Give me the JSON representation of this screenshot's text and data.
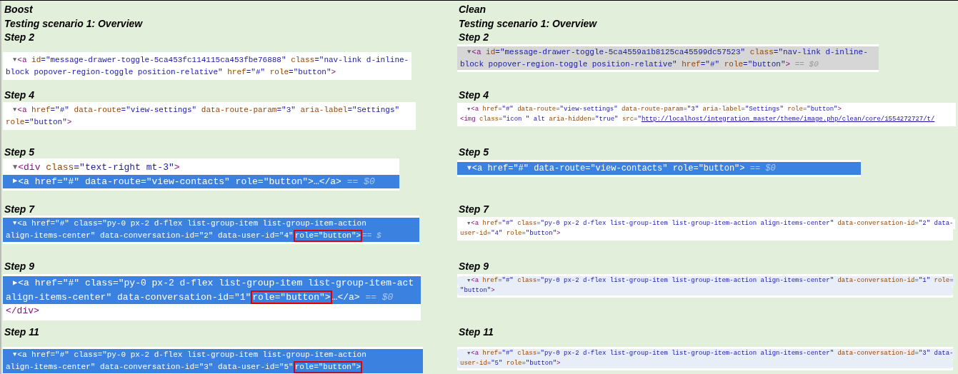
{
  "columns": [
    {
      "title": "Boost",
      "scenario": "Testing scenario 1: Overview",
      "steps": [
        {
          "label": "Step 2",
          "rows": [
            {
              "kind": "plain",
              "caret": "▼",
              "segments": [
                {
                  "kind": "code",
                  "text": "<a id=\"message-drawer-toggle-5ca453fc114115ca453fbe76888\" class=\"nav-link d-inline-"
                }
              ]
            },
            {
              "kind": "plain",
              "caret": "",
              "segments": [
                {
                  "kind": "code",
                  "text": "block popover-region-toggle position-relative\" href=\"#\" role=\"button\">"
                }
              ]
            }
          ]
        },
        {
          "label": "Step 4",
          "rows": [
            {
              "kind": "plain",
              "caret": "▼",
              "segments": [
                {
                  "kind": "code",
                  "text": "<a href=\"#\" data-route=\"view-settings\" data-route-param=\"3\" aria-label=\"Settings\""
                }
              ]
            },
            {
              "kind": "plain",
              "caret": "",
              "segments": [
                {
                  "kind": "code",
                  "text": "role=\"button\">"
                }
              ]
            }
          ]
        },
        {
          "label": "Step 5",
          "rows": [
            {
              "kind": "plain",
              "caret": "▼",
              "segments": [
                {
                  "kind": "code",
                  "text": "<div class=\"text-right mt-3\">"
                }
              ]
            },
            {
              "kind": "selected",
              "caret": "▶",
              "segments": [
                {
                  "kind": "code",
                  "text": "<a href=\"#\" data-route=\"view-contacts\" role=\"button\">…</a> == $0"
                }
              ]
            }
          ]
        },
        {
          "label": "Step 7",
          "rows": [
            {
              "kind": "selected",
              "caret": "▼",
              "segments": [
                {
                  "kind": "code",
                  "text": "<a href=\"#\" class=\"py-0 px-2 d-flex list-group-item list-group-item-action"
                }
              ]
            },
            {
              "kind": "selected",
              "caret": "",
              "segments": [
                {
                  "kind": "code",
                  "text": "align-items-center\" data-conversation-id=\"2\" data-user-id=\"4\" "
                },
                {
                  "kind": "boxed",
                  "text": "role=\"button\">"
                },
                {
                  "kind": "code",
                  "text": " == $"
                }
              ]
            }
          ]
        },
        {
          "label": "Step 9",
          "rows": [
            {
              "kind": "selected",
              "caret": "▶",
              "segments": [
                {
                  "kind": "code",
                  "text": "<a href=\"#\" class=\"py-0 px-2 d-flex list-group-item list-group-item-act"
                }
              ]
            },
            {
              "kind": "selected",
              "caret": "",
              "segments": [
                {
                  "kind": "code",
                  "text": "align-items-center\" data-conversation-id=\"1\" "
                },
                {
                  "kind": "boxed",
                  "text": "role=\"button\">"
                },
                {
                  "kind": "code",
                  "text": "…</a> == $0"
                }
              ]
            },
            {
              "kind": "plain",
              "caret": "",
              "segments": [
                {
                  "kind": "code",
                  "text": "</div>"
                }
              ]
            }
          ]
        },
        {
          "label": "Step 11",
          "rows": [
            {
              "kind": "selected",
              "caret": "▼",
              "segments": [
                {
                  "kind": "code",
                  "text": "<a href=\"#\" class=\"py-0 px-2 d-flex list-group-item list-group-item-action"
                }
              ]
            },
            {
              "kind": "selected",
              "caret": "",
              "segments": [
                {
                  "kind": "code",
                  "text": "align-items-center\" data-conversation-id=\"3\" data-user-id=\"5\" "
                },
                {
                  "kind": "boxed",
                  "text": "role=\"button\">"
                }
              ]
            }
          ]
        }
      ]
    },
    {
      "title": "Clean",
      "scenario": "Testing scenario 1: Overview",
      "steps": [
        {
          "label": "Step 2",
          "rows": [
            {
              "kind": "hover",
              "caret": "▼",
              "segments": [
                {
                  "kind": "code",
                  "text": "<a id=\"message-drawer-toggle-5ca4559a1b8125ca45599dc57523\" class=\"nav-link d-inline-"
                }
              ]
            },
            {
              "kind": "hover",
              "caret": "",
              "segments": [
                {
                  "kind": "code",
                  "text": "block popover-region-toggle position-relative\" href=\"#\" role=\"button\"> == $0"
                }
              ]
            }
          ]
        },
        {
          "label": "Step 4",
          "rows": [
            {
              "kind": "plain",
              "caret": "▼",
              "segments": [
                {
                  "kind": "code",
                  "text": "<a href=\"#\" data-route=\"view-settings\" data-route-param=\"3\" aria-label=\"Settings\" role=\"button\">"
                }
              ]
            },
            {
              "kind": "plain",
              "caret": "",
              "segments": [
                {
                  "kind": "code",
                  "text": "<img class=\"icon \" alt aria-hidden=\"true\" src=\""
                },
                {
                  "kind": "link",
                  "text": "http://localhost/integration_master/theme/image.php/clean/core/1554272727/t/"
                }
              ]
            }
          ]
        },
        {
          "label": "Step 5",
          "rows": [
            {
              "kind": "selected",
              "caret": "▼",
              "segments": [
                {
                  "kind": "code",
                  "text": "<a href=\"#\" data-route=\"view-contacts\" role=\"button\"> == $0"
                }
              ]
            }
          ]
        },
        {
          "label": "Step 7",
          "rows": [
            {
              "kind": "plain",
              "caret": "▼",
              "segments": [
                {
                  "kind": "code",
                  "text": "<a href=\"#\" class=\"py-0 px-2 d-flex list-group-item list-group-item-action align-items-center\" data-conversation-id=\"2\" data-"
                }
              ]
            },
            {
              "kind": "plain",
              "caret": "",
              "segments": [
                {
                  "kind": "code",
                  "text": "user-id=\"4\" role=\"button\">"
                }
              ]
            }
          ]
        },
        {
          "label": "Step 9",
          "rows": [
            {
              "kind": "tinted",
              "caret": "▼",
              "segments": [
                {
                  "kind": "code",
                  "text": "<a href=\"#\" class=\"py-0 px-2 d-flex list-group-item list-group-item-action align-items-center\" data-conversation-id=\"1\" role="
                }
              ]
            },
            {
              "kind": "tinted",
              "caret": "",
              "segments": [
                {
                  "kind": "code",
                  "text": "\"button\">"
                }
              ]
            }
          ]
        },
        {
          "label": "Step 11",
          "rows": [
            {
              "kind": "tinted",
              "caret": "▼",
              "segments": [
                {
                  "kind": "code",
                  "text": "<a href=\"#\" class=\"py-0 px-2 d-flex list-group-item list-group-item-action align-items-center\" data-conversation-id=\"3\" data-"
                }
              ]
            },
            {
              "kind": "tinted",
              "caret": "",
              "segments": [
                {
                  "kind": "code",
                  "text": "user-id=\"5\" role=\"button\">"
                }
              ]
            }
          ]
        }
      ]
    }
  ]
}
